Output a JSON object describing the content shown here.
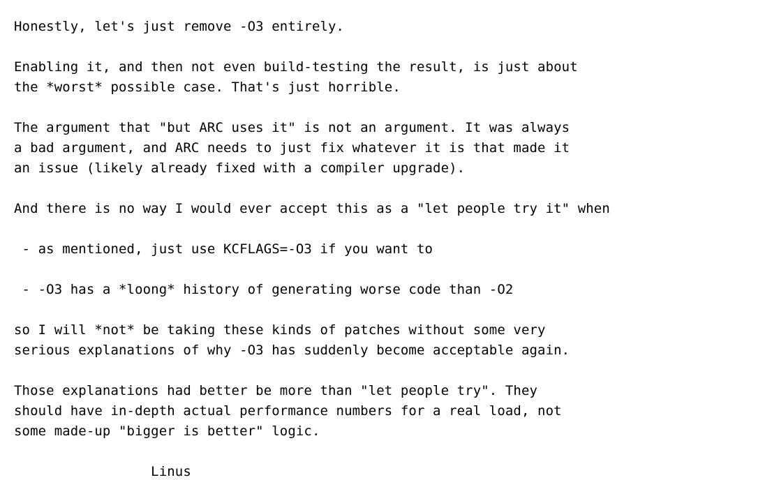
{
  "email": {
    "lines": [
      "Honestly, let's just remove -O3 entirely.",
      "",
      "Enabling it, and then not even build-testing the result, is just about",
      "the *worst* possible case. That's just horrible.",
      "",
      "The argument that \"but ARC uses it\" is not an argument. It was always",
      "a bad argument, and ARC needs to just fix whatever it is that made it",
      "an issue (likely already fixed with a compiler upgrade).",
      "",
      "And there is no way I would ever accept this as a \"let people try it\" when",
      "",
      " - as mentioned, just use KCFLAGS=-O3 if you want to",
      "",
      " - -O3 has a *loong* history of generating worse code than -O2",
      "",
      "so I will *not* be taking these kinds of patches without some very",
      "serious explanations of why -O3 has suddenly become acceptable again.",
      "",
      "Those explanations had better be more than \"let people try\". They",
      "should have in-depth actual performance numbers for a real load, not",
      "some made-up \"bigger is better\" logic.",
      "",
      "                 Linus"
    ]
  }
}
